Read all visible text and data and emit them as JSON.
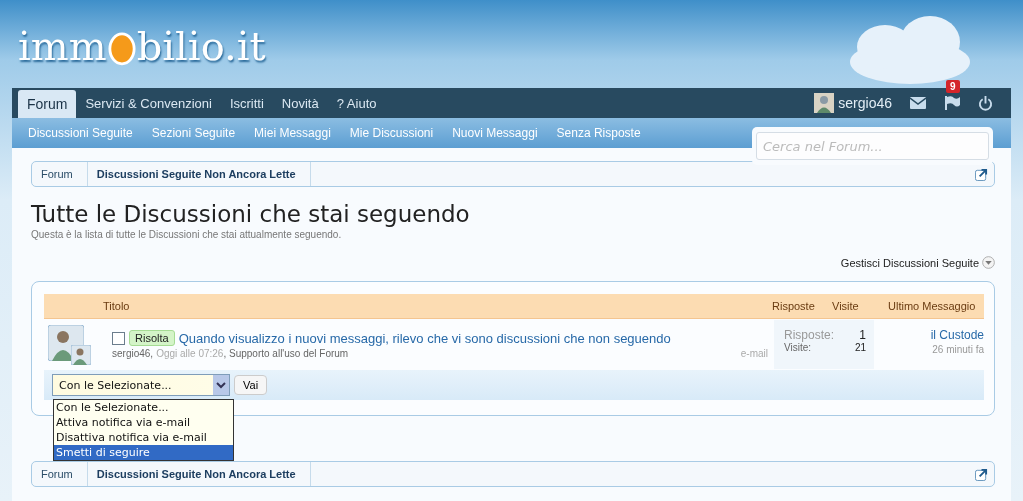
{
  "logo": {
    "before": "imm",
    "after": "bilio.it"
  },
  "nav": {
    "tabs": [
      {
        "label": "Forum",
        "selected": true
      },
      {
        "label": "Servizi & Convenzioni",
        "selected": false
      },
      {
        "label": "Iscritti",
        "selected": false
      },
      {
        "label": "Novità",
        "selected": false
      },
      {
        "label": "? Aiuto",
        "selected": false
      }
    ],
    "user": "sergio46",
    "alert_count": "9"
  },
  "subnav": [
    "Discussioni Seguite",
    "Sezioni Seguite",
    "Miei Messaggi",
    "Mie Discussioni",
    "Nuovi Messaggi",
    "Senza Risposte"
  ],
  "search": {
    "placeholder": "Cerca nel Forum..."
  },
  "breadcrumb": [
    "Forum",
    "Discussioni Seguite Non Ancora Lette"
  ],
  "title": "Tutte le Discussioni che stai seguendo",
  "description": "Questa è la lista di tutte le Discussioni che stai attualmente seguendo.",
  "manage_link": "Gestisci Discussioni Seguite",
  "table": {
    "columns": [
      "Titolo",
      "Risposte",
      "Visite",
      "Ultimo Messaggio"
    ],
    "rows": [
      {
        "checked": false,
        "prefix": "Risolta",
        "title": "Quando visualizzo i nuovi messaggi, rilevo che vi sono discussioni che non seguendo",
        "author": "sergio46,",
        "date": "Oggi alle 07:26",
        "forum": ", Supporto all'uso del Forum",
        "notify": "e-mail",
        "replies_label": "Risposte:",
        "replies": "1",
        "views_label": "Visite:",
        "views": "21",
        "last_user": "il Custode",
        "last_time": "26 minuti fa"
      }
    ]
  },
  "bulk": {
    "value": "Con le Selezionate...",
    "button": "Vai",
    "options": [
      {
        "label": "Con le Selezionate...",
        "highlighted": false
      },
      {
        "label": "Attiva notifica via e-mail",
        "highlighted": false
      },
      {
        "label": "Disattiva notifica via e-mail",
        "highlighted": false
      },
      {
        "label": "Smetti di seguire",
        "highlighted": true
      }
    ]
  },
  "breadcrumb_bottom": [
    "Forum",
    "Discussioni Seguite Non Ancora Lette"
  ]
}
